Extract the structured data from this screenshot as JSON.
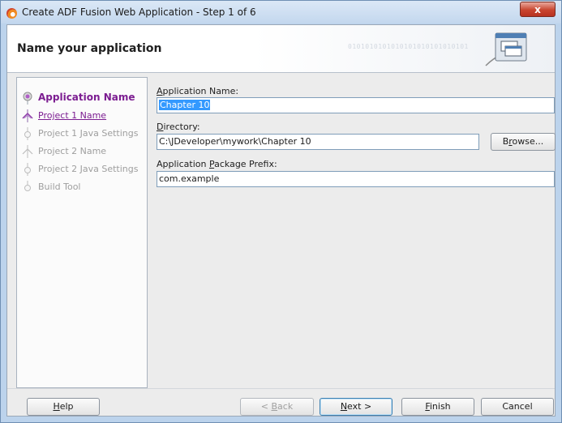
{
  "window": {
    "title": "Create ADF Fusion Web Application - Step 1 of 6",
    "close_glyph": "x"
  },
  "header": {
    "title": "Name your application",
    "binary_text": "0101010101010101010101010101",
    "graphic_icon": "window-wizard-icon"
  },
  "nav": {
    "items": [
      {
        "label": "Application Name",
        "state": "active"
      },
      {
        "label": "Project 1 Name",
        "state": "link"
      },
      {
        "label": "Project 1 Java Settings",
        "state": "disabled"
      },
      {
        "label": "Project 2 Name",
        "state": "disabled"
      },
      {
        "label": "Project 2 Java Settings",
        "state": "disabled"
      },
      {
        "label": "Build Tool",
        "state": "disabled"
      }
    ]
  },
  "form": {
    "app_name": {
      "label_mnemonic": "A",
      "label_rest": "pplication Name:",
      "value": "Chapter 10"
    },
    "directory": {
      "label_mnemonic": "D",
      "label_rest": "irectory:",
      "value": "C:\\JDeveloper\\mywork\\Chapter 10",
      "browse_pre": "B",
      "browse_mnemonic": "r",
      "browse_post": "owse..."
    },
    "package_prefix": {
      "label_pre": "Application ",
      "label_mnemonic": "P",
      "label_rest": "ackage Prefix:",
      "value": "com.example"
    }
  },
  "footer": {
    "help": {
      "mnemonic": "H",
      "rest": "elp"
    },
    "back": {
      "pre": "< ",
      "mnemonic": "B",
      "rest": "ack"
    },
    "next": {
      "mnemonic": "N",
      "rest": "ext >"
    },
    "finish": {
      "mnemonic": "F",
      "rest": "inish"
    },
    "cancel": "Cancel"
  },
  "colors": {
    "accent_purple": "#7c1d91",
    "selection": "#3399ff",
    "disabled_text": "#9e9e9e"
  }
}
